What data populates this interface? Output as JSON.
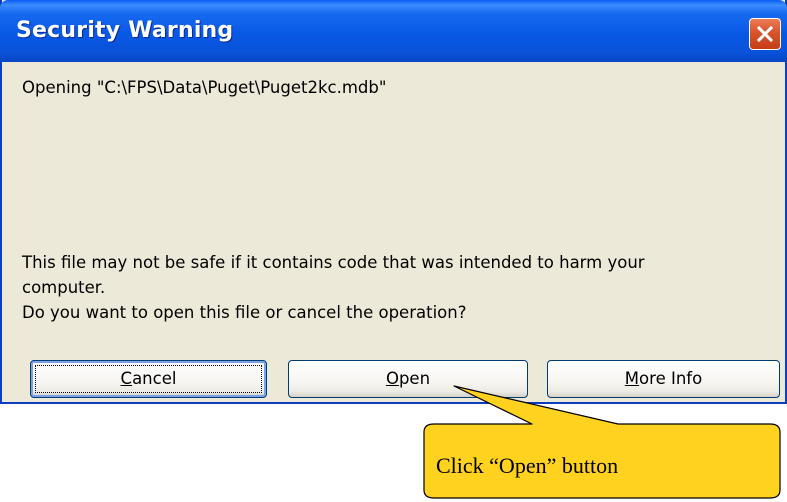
{
  "dialog": {
    "title": "Security Warning",
    "close_label": "close",
    "message_path": "Opening \"C:\\FPS\\Data\\Puget\\Puget2kc.mdb\"",
    "warning_lines": [
      "This file may not be safe if it contains code that was intended to harm your",
      "computer.",
      "Do you want to open this file or cancel the operation?"
    ],
    "buttons": {
      "cancel": {
        "accel": "C",
        "rest": "ancel"
      },
      "open": {
        "accel": "O",
        "rest": "pen"
      },
      "more_info": {
        "accel": "M",
        "rest": "ore Info"
      }
    }
  },
  "callout": {
    "text": "Click “Open” button",
    "fill_color": "#ffd21f",
    "stroke_color": "#000000"
  },
  "colors": {
    "titlebar_blue": "#0858e6",
    "dialog_bg": "#ece9d8",
    "close_red": "#d9532c"
  }
}
